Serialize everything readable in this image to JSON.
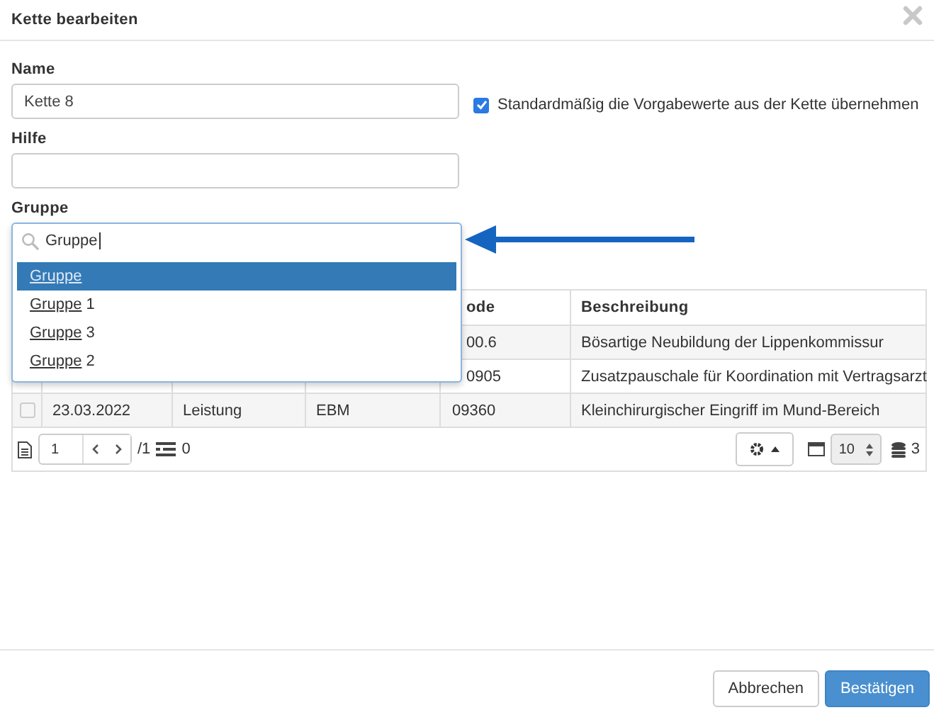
{
  "dialog": {
    "title": "Kette bearbeiten"
  },
  "fields": [
    {
      "label": "Name",
      "value": "Kette 8"
    },
    {
      "label": "Hilfe"
    }
  ],
  "default_option": {
    "label": "Standardmäßig die Vorgabewerte aus der Kette übernehmen",
    "checked": true
  },
  "group": {
    "label": "Gruppe",
    "search_value": "Gruppe",
    "options": [
      {
        "match": "Gruppe",
        "selected": true
      },
      {
        "match": "Gruppe",
        "rest": " 1",
        "selected": false
      },
      {
        "match": "Gruppe",
        "rest": " 3",
        "selected": false
      },
      {
        "match": "Gruppe",
        "rest": " 2",
        "selected": false
      }
    ]
  },
  "table": {
    "header": {
      "column_5": "ode",
      "column_6": "Beschreibung"
    },
    "rows": [
      {
        "column_5": "00.6",
        "column_6": "Bösartige Neubildung der Lippenkommissur"
      },
      {
        "column_5": "0905",
        "column_6": "Zusatzpauschale für Koordination mit Vertragsarzt"
      },
      {
        "checked": false,
        "column_2": "23.03.2022",
        "column_3": "Leistung",
        "column_4": "EBM",
        "column_5": "09360",
        "column_6": "Kleinchirurgischer Eingriff im Mund-Bereich"
      }
    ]
  },
  "pager": {
    "page": "1",
    "total": "/1",
    "selected_count": "0",
    "page_size": "10",
    "record_count": "3"
  },
  "buttons": [
    {
      "label": "Abbrechen",
      "kind": "default"
    },
    {
      "label": "Bestätigen",
      "kind": "primary"
    }
  ]
}
